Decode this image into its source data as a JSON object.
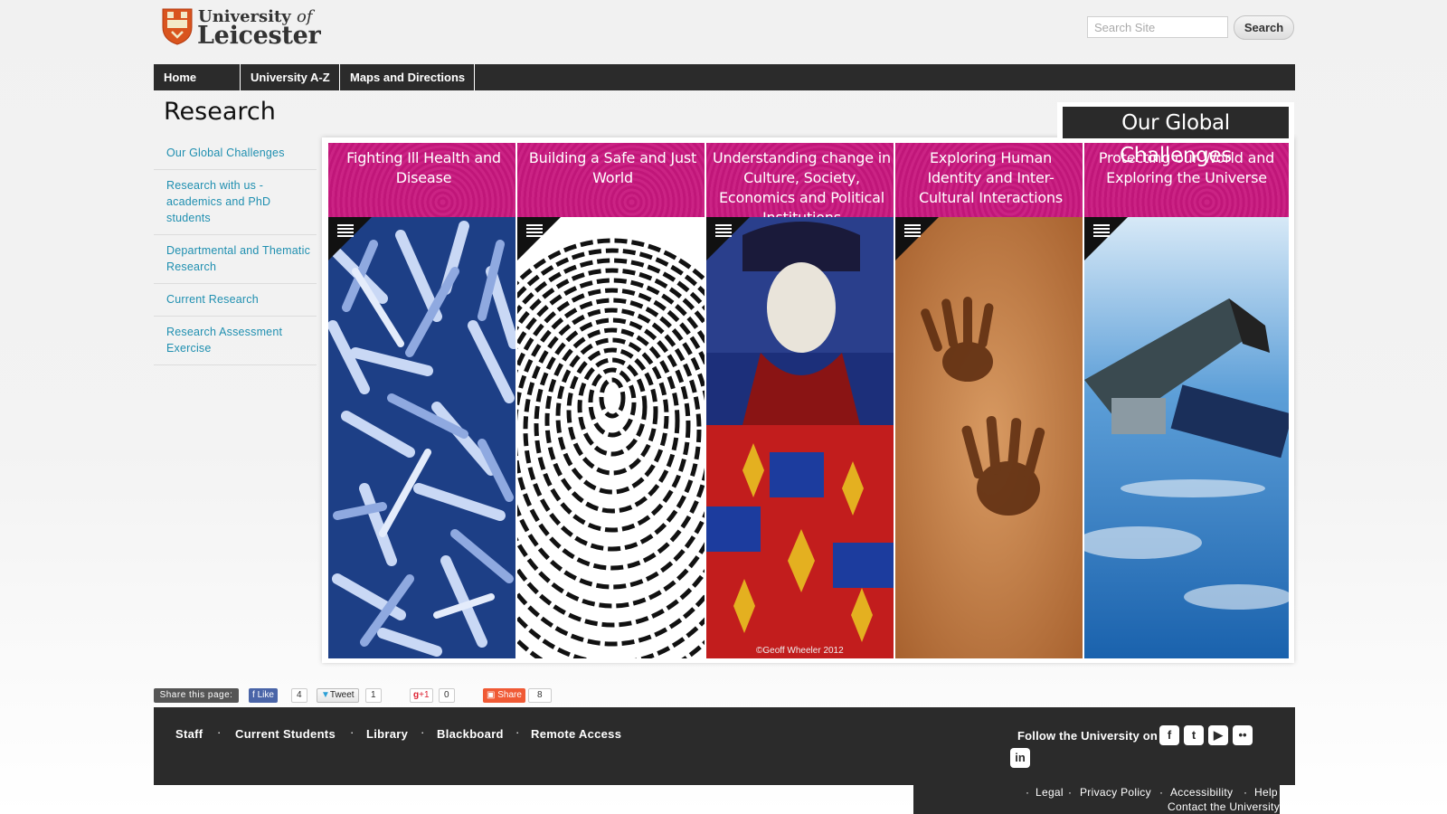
{
  "header": {
    "logo_line1_a": "University",
    "logo_line1_b": "of",
    "logo_line2": "Leicester",
    "search_placeholder": "Search Site",
    "search_button": "Search"
  },
  "topnav": [
    "Home",
    "University A-Z",
    "Maps and Directions"
  ],
  "page_title": "Research",
  "sidemenu": [
    "Our Global Challenges",
    "Research with us - academics and PhD students",
    "Departmental and Thematic Research",
    "Current Research",
    "Research Assessment Exercise"
  ],
  "challenges": {
    "heading": "Our Global Challenges",
    "columns": [
      {
        "title": "Fighting Ill Health and Disease",
        "image_icon": "bacteria-image"
      },
      {
        "title": "Building a Safe and Just World",
        "image_icon": "fingerprint-image"
      },
      {
        "title": "Understanding change in Culture, Society, Economics and Political Institutions",
        "image_icon": "stained-glass-king-image"
      },
      {
        "title": "Exploring Human Identity and Inter-Cultural Interactions",
        "image_icon": "handprints-in-sand-image"
      },
      {
        "title": "Protecting our World and Exploring the Universe",
        "image_icon": "satellite-over-earth-image"
      }
    ],
    "credit": "©Geoff Wheeler 2012",
    "accent_color": "#c8177e"
  },
  "share": {
    "label": "Share this page:",
    "like_label": "Like",
    "like_count": "4",
    "tweet_label": "Tweet",
    "tweet_count": "1",
    "gplus_label": "+1",
    "gplus_count": "0",
    "share_label": "Share",
    "share_count": "8"
  },
  "footer": {
    "links": [
      "Staff",
      "Current Students",
      "Library",
      "Blackboard",
      "Remote Access"
    ],
    "follow_text": "Follow the University on",
    "social_icons": [
      "facebook-icon",
      "twitter-icon",
      "youtube-icon",
      "flickr-icon",
      "linkedin-icon"
    ],
    "legal_links": [
      "Legal",
      "Privacy Policy",
      "Accessibility",
      "Help"
    ],
    "contact": "Contact the University"
  }
}
